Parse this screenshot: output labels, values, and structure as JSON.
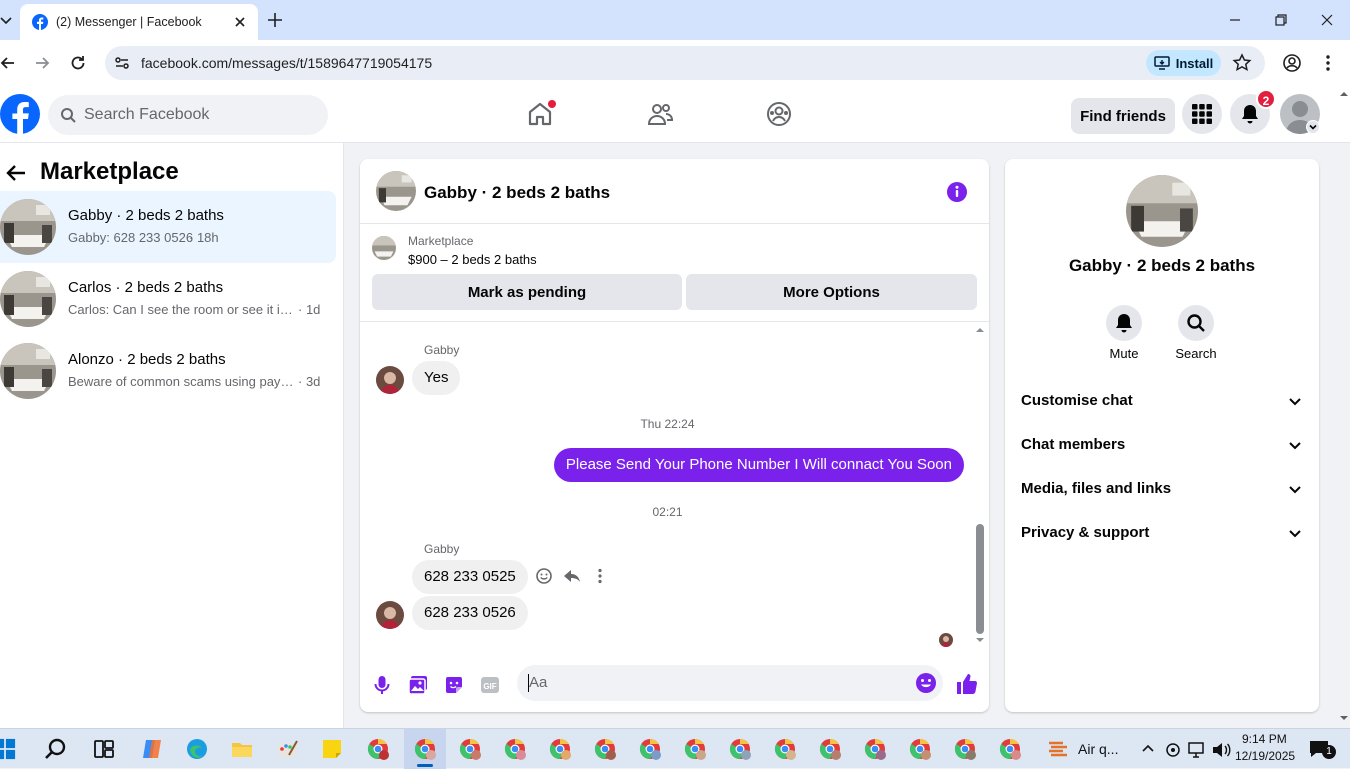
{
  "browser": {
    "tab_title": "(2) Messenger | Facebook",
    "url": "facebook.com/messages/t/1589647719054175",
    "install_label": "Install"
  },
  "fb_header": {
    "search_placeholder": "Search Facebook",
    "find_friends_label": "Find friends",
    "notification_count": "2",
    "brand_color": "#0866ff"
  },
  "sidebar": {
    "title": "Marketplace",
    "conversations": [
      {
        "name": "Gabby · 2 beds 2 baths",
        "preview": "Gabby: 628 233 0526",
        "time": "· 18h",
        "active": true
      },
      {
        "name": "Carlos · 2 beds 2 baths",
        "preview": "Carlos: Can I see the room or see it in person",
        "time": "· 1d",
        "active": false
      },
      {
        "name": "Alonzo · 2 beds 2 baths",
        "preview": "Beware of common scams using payment apps",
        "time": "· 3d",
        "active": false
      }
    ]
  },
  "chat": {
    "title": "Gabby · 2 beds 2 baths",
    "listing_label": "Marketplace",
    "listing_price": "$900 – 2 beds 2 baths",
    "mark_pending_label": "Mark as pending",
    "more_options_label": "More Options",
    "accent_color": "#7a21ec",
    "messages": [
      {
        "sender": "Gabby",
        "text": "Yes"
      },
      {
        "timestamp": "Thu 22:24"
      },
      {
        "sender": "me",
        "text": "Please Send Your Phone Number I Will connact You Soon"
      },
      {
        "timestamp": "02:21"
      },
      {
        "sender": "Gabby",
        "text": "628 233 0525"
      },
      {
        "sender": "Gabby",
        "text": "628 233 0526"
      }
    ],
    "composer_placeholder": "Aa"
  },
  "details": {
    "name": "Gabby · 2 beds 2 baths",
    "actions": [
      {
        "label": "Mute"
      },
      {
        "label": "Search"
      }
    ],
    "sections": [
      {
        "label": "Customise chat"
      },
      {
        "label": "Chat members"
      },
      {
        "label": "Media, files and links"
      },
      {
        "label": "Privacy & support"
      }
    ]
  },
  "taskbar": {
    "weather": "Air q...",
    "time": "9:14 PM",
    "date": "12/19/2025",
    "notif_count": "1"
  }
}
